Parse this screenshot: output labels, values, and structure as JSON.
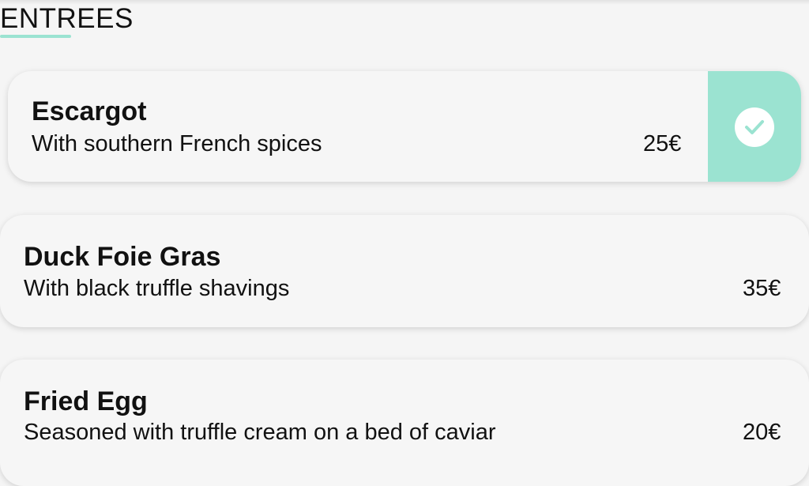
{
  "section": {
    "title": "ENTREES"
  },
  "accent_color": "#9be3d1",
  "items": [
    {
      "name": "Escargot",
      "description": "With southern French spices",
      "price": "25€",
      "selected": true,
      "selected_icon": "check-icon"
    },
    {
      "name": "Duck Foie Gras",
      "description": "With black truffle shavings",
      "price": "35€",
      "selected": false
    },
    {
      "name": "Fried Egg",
      "description": "Seasoned with truffle cream on a bed of caviar",
      "price": "20€",
      "selected": false
    }
  ]
}
